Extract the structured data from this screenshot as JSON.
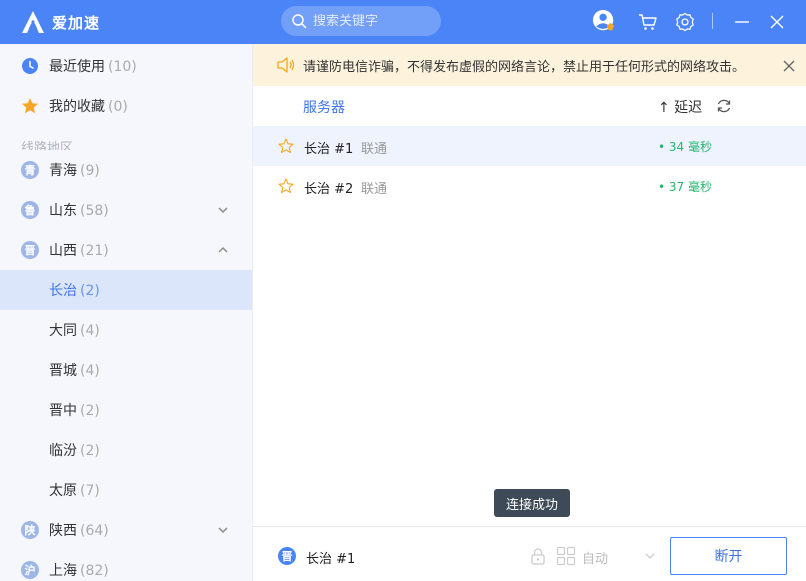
{
  "app": {
    "name": "爱加速"
  },
  "search": {
    "placeholder": "搜索关键字"
  },
  "sidebar": {
    "recent": {
      "label": "最近使用",
      "count": "(10)"
    },
    "favorites": {
      "label": "我的收藏",
      "count": "(0)"
    },
    "section_title": "线路地区",
    "provinces": [
      {
        "badge": "青",
        "label": "青海",
        "count": "(9)"
      },
      {
        "badge": "鲁",
        "label": "山东",
        "count": "(58)"
      },
      {
        "badge": "晋",
        "label": "山西",
        "count": "(21)"
      }
    ],
    "cities": [
      {
        "label": "长治",
        "count": "(2)"
      },
      {
        "label": "大同",
        "count": "(4)"
      },
      {
        "label": "晋城",
        "count": "(4)"
      },
      {
        "label": "晋中",
        "count": "(2)"
      },
      {
        "label": "临汾",
        "count": "(2)"
      },
      {
        "label": "太原",
        "count": "(7)"
      }
    ],
    "provinces_after": [
      {
        "badge": "陕",
        "label": "陕西",
        "count": "(64)"
      },
      {
        "badge": "沪",
        "label": "上海",
        "count": "(82)"
      }
    ]
  },
  "notice": {
    "text": "请谨防电信诈骗，不得发布虚假的网络言论，禁止用于任何形式的网络攻击。"
  },
  "table": {
    "col_server": "服务器",
    "col_latency": "↑ 延迟",
    "rows": [
      {
        "name": "长治 #1",
        "isp": "联通",
        "latency": "• 34 毫秒"
      },
      {
        "name": "长治 #2",
        "isp": "联通",
        "latency": "• 37 毫秒"
      }
    ]
  },
  "toast": {
    "text": "连接成功"
  },
  "bottom": {
    "current_badge": "晋",
    "current_server": "长治 #1",
    "mode": "自动",
    "disconnect": "断开"
  },
  "colors": {
    "brand": "#4b84f6",
    "latency_ok": "#21b86f",
    "notice_bg": "#fdf3dc"
  }
}
